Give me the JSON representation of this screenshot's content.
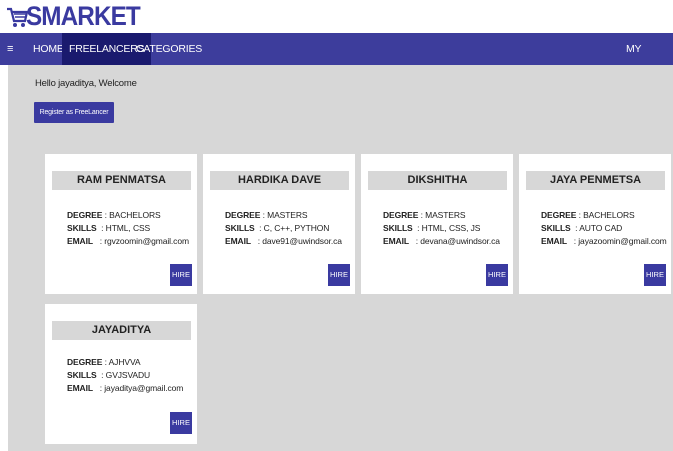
{
  "brand": {
    "logo_text": "SMARKET",
    "cart_icon": "shopping-cart-icon"
  },
  "nav": {
    "menu_icon": "≡",
    "items": [
      {
        "label": "HOME"
      },
      {
        "label": "FREELANCERS"
      },
      {
        "label": "CATEGORIES"
      }
    ],
    "account_label": "MY ACCOUNT"
  },
  "main": {
    "welcome": "Hello jayaditya, Welcome",
    "register_label": "Register as FreeLancer"
  },
  "labels": {
    "degree": "DEGREE",
    "skills": "SKILLS",
    "email": "EMAIL",
    "hire": "HIRE"
  },
  "freelancers": [
    {
      "name": "RAM PENMATSA",
      "degree": ": BACHELORS",
      "skills": ": HTML, CSS",
      "email": ": rgvzoomin@gmail.com"
    },
    {
      "name": "HARDIKA DAVE",
      "degree": ": MASTERS",
      "skills": ": C, C++, PYTHON",
      "email": ": dave91@uwindsor.ca"
    },
    {
      "name": "DIKSHITHA",
      "degree": ": MASTERS",
      "skills": ": HTML, CSS, JS",
      "email": ": devana@uwindsor.ca"
    },
    {
      "name": "JAYA PENMETSA",
      "degree": ": BACHELORS",
      "skills": ": AUTO CAD",
      "email": ": jayazoomin@gmail.com"
    },
    {
      "name": "JAYADITYA",
      "degree": ": AJHVVA",
      "skills": ": GVJSVADU",
      "email": ": jayaditya@gmail.com"
    }
  ],
  "colors": {
    "primary": "#3d3d9c",
    "active_nav": "#1a1a6e",
    "page_bg": "#d7d7d7",
    "button": "#3a3aa0"
  }
}
